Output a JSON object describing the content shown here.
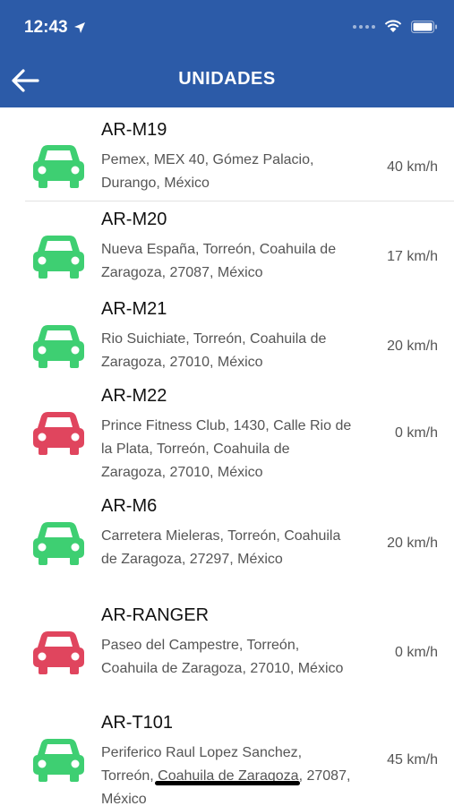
{
  "status_bar": {
    "time": "12:43"
  },
  "header": {
    "title": "UNIDADES"
  },
  "colors": {
    "header": "#2c5ba8",
    "active": "#3ecf72",
    "stopped": "#e0455e"
  },
  "units": [
    {
      "name": "AR-M19",
      "address": "Pemex, MEX 40, Gómez Palacio, Durango, México",
      "speed": "40 km/h",
      "status": "active"
    },
    {
      "name": "AR-M20",
      "address": "Nueva España, Torreón, Coahuila de Zaragoza, 27087, México",
      "speed": "17 km/h",
      "status": "active"
    },
    {
      "name": "AR-M21",
      "address": "Rio Suichiate, Torreón, Coahuila de Zaragoza, 27010, México",
      "speed": "20 km/h",
      "status": "active"
    },
    {
      "name": "AR-M22",
      "address": "Prince Fitness Club, 1430, Calle Rio de la Plata, Torreón, Coahuila de Zaragoza, 27010, México",
      "speed": "0 km/h",
      "status": "stopped"
    },
    {
      "name": "AR-M6",
      "address": "Carretera Mieleras, Torreón, Coahuila de Zaragoza, 27297, México",
      "speed": "20 km/h",
      "status": "active"
    },
    {
      "name": "AR-RANGER",
      "address": "Paseo del Campestre, Torreón, Coahuila de Zaragoza, 27010, México",
      "speed": "0 km/h",
      "status": "stopped"
    },
    {
      "name": "AR-T101",
      "address": "Periferico Raul Lopez Sanchez, Torreón, Coahuila de Zaragoza, 27087, México",
      "speed": "45 km/h",
      "status": "active"
    }
  ]
}
